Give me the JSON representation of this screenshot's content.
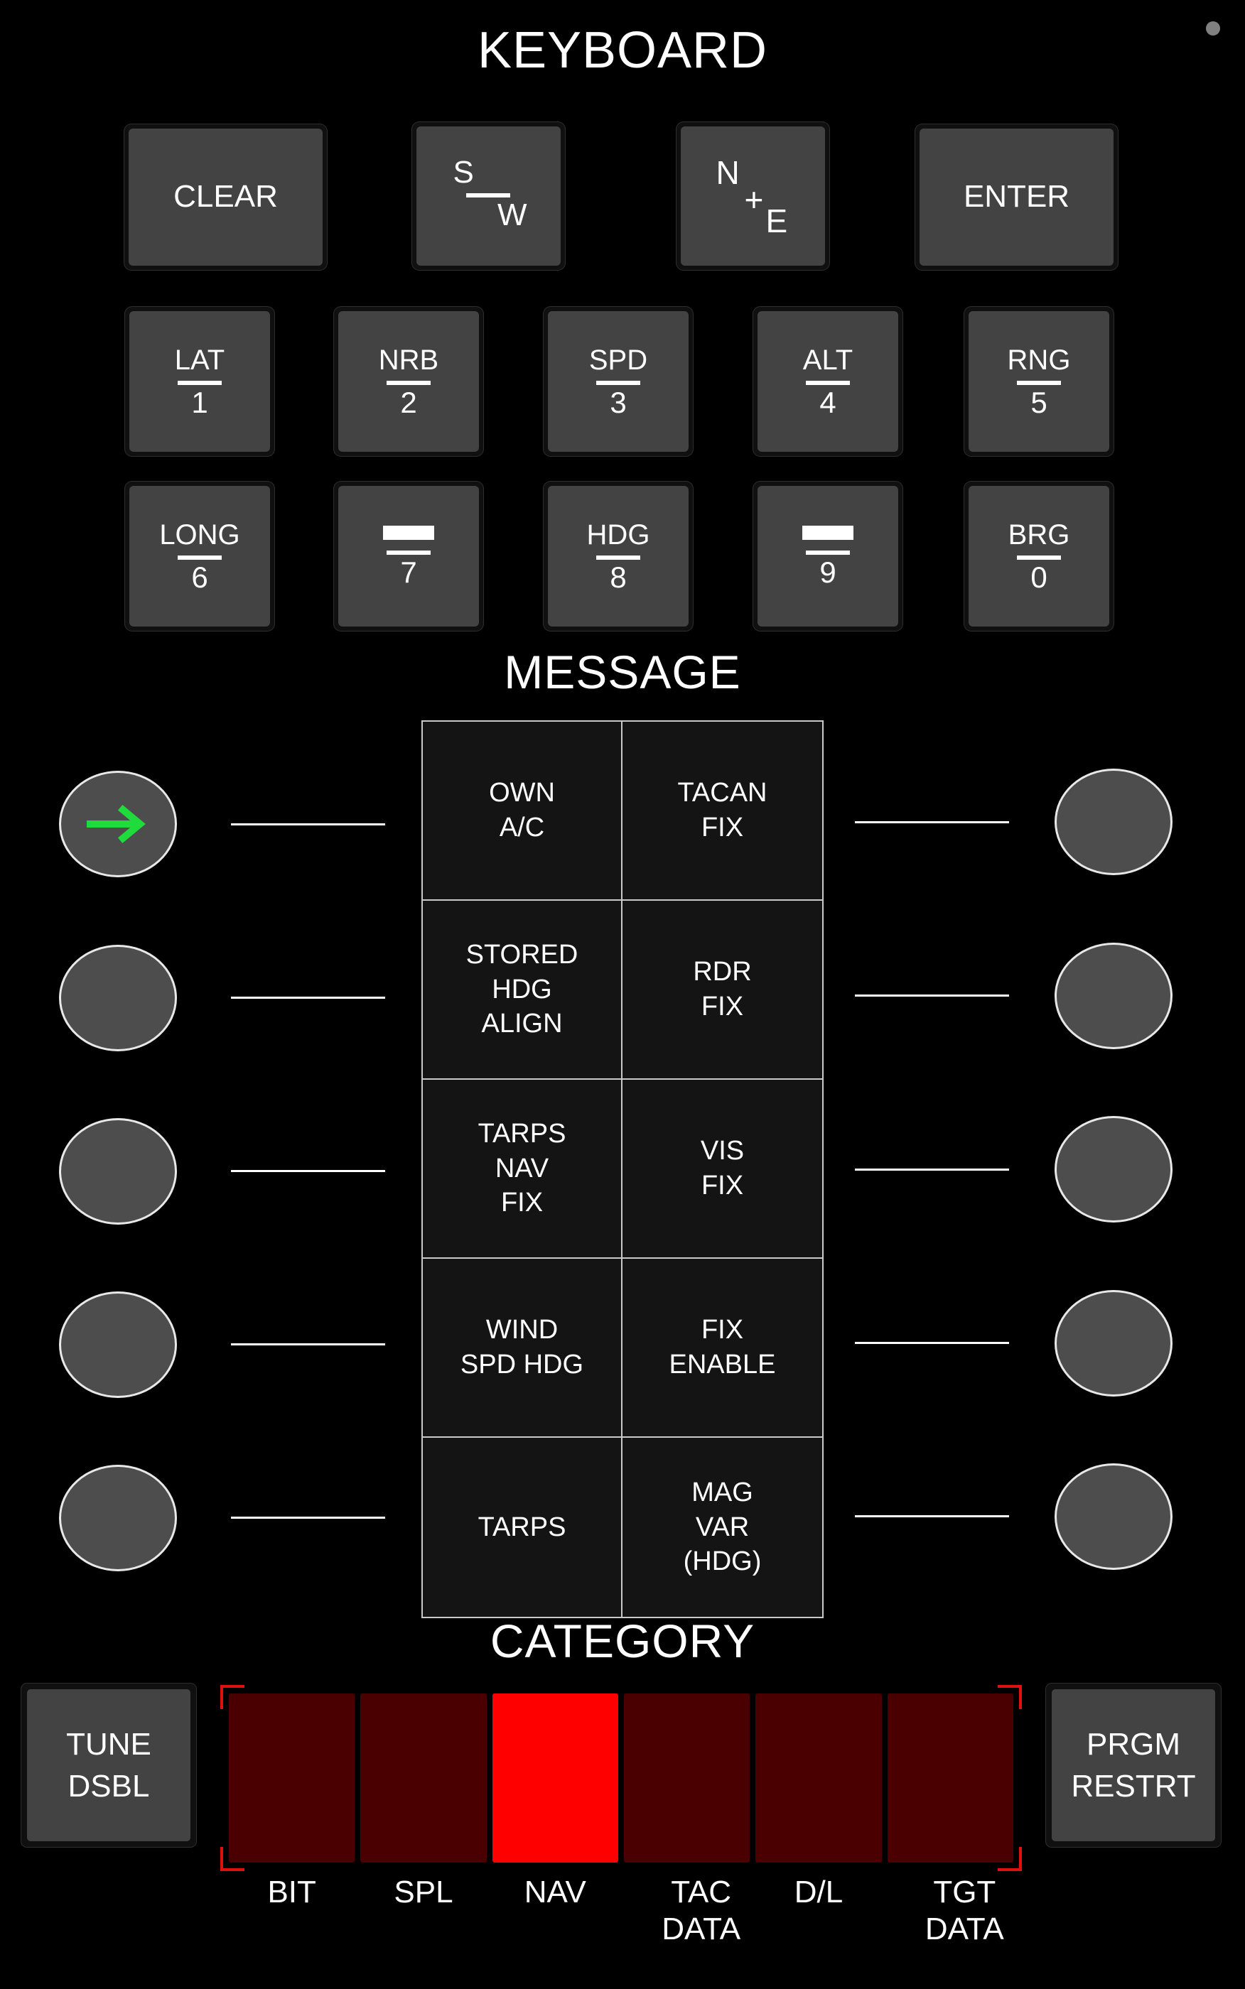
{
  "panel": {
    "screw_icon": "screw-dot"
  },
  "keyboard": {
    "title": "KEYBOARD",
    "row1": [
      {
        "id": "clear",
        "label": "CLEAR",
        "type": "text"
      },
      {
        "id": "sw",
        "label": "S/W",
        "type": "sw",
        "top": "S",
        "bottom": "W"
      },
      {
        "id": "ne",
        "label": "N+E",
        "type": "ne",
        "top": "N",
        "plus": "+",
        "bottom": "E"
      },
      {
        "id": "enter",
        "label": "ENTER",
        "type": "text"
      }
    ],
    "row2": [
      {
        "id": "lat",
        "top": "LAT",
        "bot": "1",
        "blank": false
      },
      {
        "id": "nrb",
        "top": "NRB",
        "bot": "2",
        "blank": false
      },
      {
        "id": "spd",
        "top": "SPD",
        "bot": "3",
        "blank": false
      },
      {
        "id": "alt",
        "top": "ALT",
        "bot": "4",
        "blank": false
      },
      {
        "id": "rng",
        "top": "RNG",
        "bot": "5",
        "blank": false
      }
    ],
    "row3": [
      {
        "id": "long",
        "top": "LONG",
        "bot": "6",
        "blank": false
      },
      {
        "id": "key7",
        "top": "",
        "bot": "7",
        "blank": true
      },
      {
        "id": "hdg",
        "top": "HDG",
        "bot": "8",
        "blank": false
      },
      {
        "id": "key9",
        "top": "",
        "bot": "9",
        "blank": true
      },
      {
        "id": "brg",
        "top": "BRG",
        "bot": "0",
        "blank": false
      }
    ]
  },
  "message": {
    "title": "MESSAGE",
    "cells": [
      "OWN\nA/C",
      "TACAN\nFIX",
      "STORED\nHDG\nALIGN",
      "RDR\nFIX",
      "TARPS\nNAV\nFIX",
      "VIS\nFIX",
      "WIND\nSPD HDG",
      "FIX\nENABLE",
      "TARPS",
      "MAG\nVAR\n(HDG)"
    ],
    "left_buttons": [
      {
        "id": "msg-l1",
        "selected": true,
        "icon": "arrow-right-icon",
        "accent": "#1fdb3c"
      },
      {
        "id": "msg-l2",
        "selected": false,
        "icon": "",
        "accent": ""
      },
      {
        "id": "msg-l3",
        "selected": false,
        "icon": "",
        "accent": ""
      },
      {
        "id": "msg-l4",
        "selected": false,
        "icon": "",
        "accent": ""
      },
      {
        "id": "msg-l5",
        "selected": false,
        "icon": "",
        "accent": ""
      }
    ],
    "right_buttons": [
      {
        "id": "msg-r1",
        "selected": false
      },
      {
        "id": "msg-r2",
        "selected": false
      },
      {
        "id": "msg-r3",
        "selected": false
      },
      {
        "id": "msg-r4",
        "selected": false
      },
      {
        "id": "msg-r5",
        "selected": false
      }
    ]
  },
  "category": {
    "title": "CATEGORY",
    "selected": "NAV",
    "colors": {
      "lit": "#ff0000",
      "unlit": "#4a0000",
      "bracket": "#e01010"
    },
    "items": [
      {
        "id": "bit",
        "label": "BIT",
        "lit": false,
        "two_line": false
      },
      {
        "id": "spl",
        "label": "SPL",
        "lit": false,
        "two_line": false
      },
      {
        "id": "nav",
        "label": "NAV",
        "lit": true,
        "two_line": false
      },
      {
        "id": "tac-data",
        "label": "TAC\nDATA",
        "lit": false,
        "two_line": true
      },
      {
        "id": "dl",
        "label": "D/L",
        "lit": false,
        "two_line": false
      },
      {
        "id": "tgt-data",
        "label": "TGT\nDATA",
        "lit": false,
        "two_line": true
      }
    ]
  },
  "side_buttons": {
    "tune_dsbl": "TUNE\nDSBL",
    "prgm_restrt": "PRGM\nRESTRT"
  }
}
